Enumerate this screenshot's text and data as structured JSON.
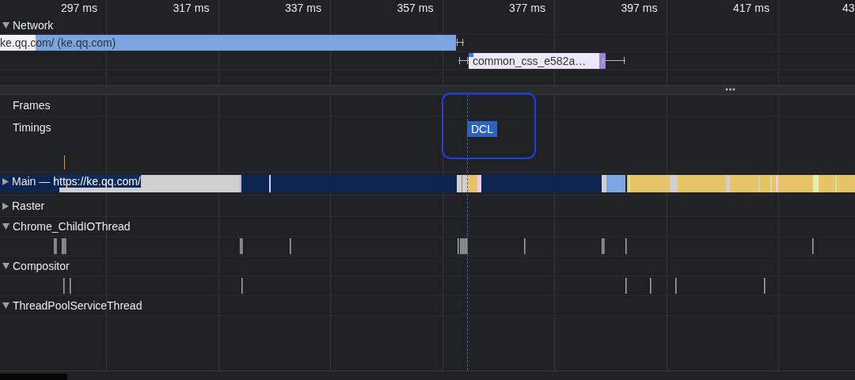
{
  "ruler": {
    "ticks": [
      "297 ms",
      "317 ms",
      "337 ms",
      "357 ms",
      "377 ms",
      "397 ms",
      "417 ms",
      "43"
    ]
  },
  "network": {
    "name": "Network",
    "expanded": true,
    "requests": [
      {
        "label": "ke.qq.com/ (ke.qq.com)"
      },
      {
        "label": "common_css_e582a…"
      }
    ]
  },
  "tracks": [
    {
      "kind": "frames",
      "name": "Frames"
    },
    {
      "kind": "timings",
      "name": "Timings",
      "markers": [
        {
          "label": "DCL"
        }
      ]
    },
    {
      "kind": "main",
      "name": "Main —",
      "url": "https://ke.qq.com/",
      "expanded": false
    },
    {
      "kind": "thread",
      "name": "Raster",
      "expanded": false
    },
    {
      "kind": "thread",
      "name": "Chrome_ChildIOThread",
      "expanded": true
    },
    {
      "kind": "thread",
      "name": "Compositor",
      "expanded": true
    },
    {
      "kind": "thread",
      "name": "ThreadPoolServiceThread",
      "expanded": true
    }
  ]
}
